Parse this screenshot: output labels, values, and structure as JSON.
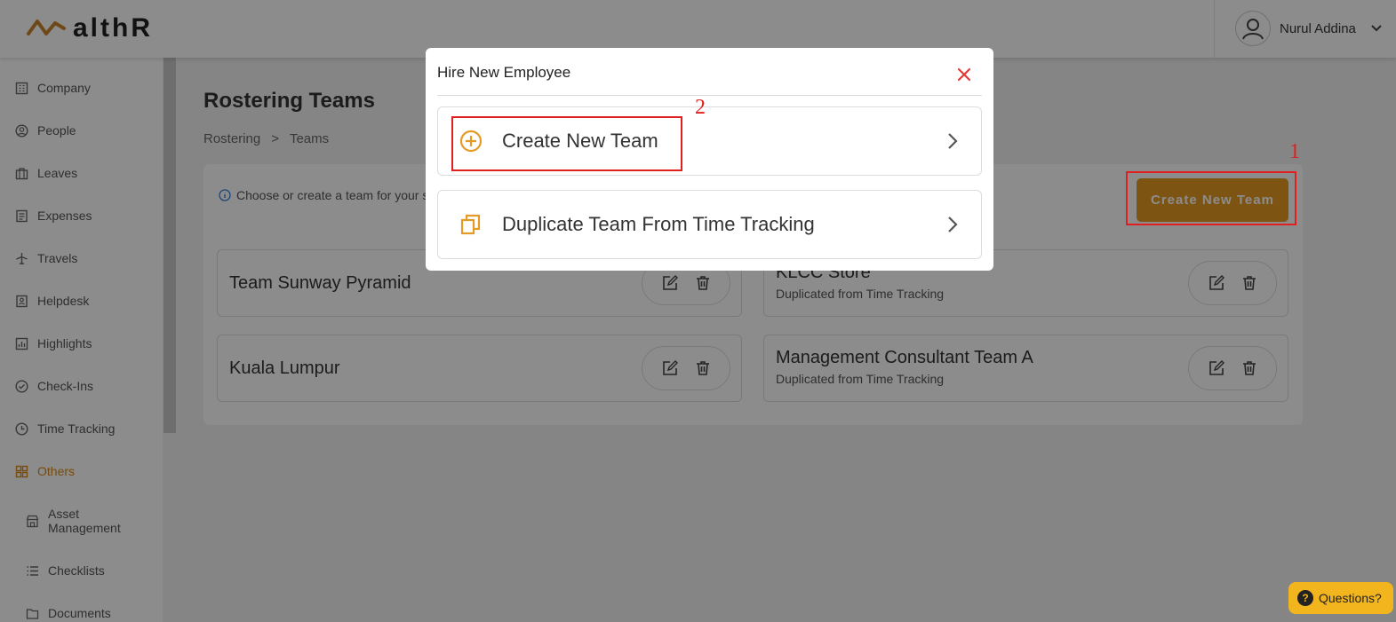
{
  "header": {
    "logo_text": "althR",
    "user_name": "Nurul Addina"
  },
  "sidebar": {
    "items": [
      {
        "label": "Company",
        "icon": "building-icon"
      },
      {
        "label": "People",
        "icon": "user-circle-icon"
      },
      {
        "label": "Leaves",
        "icon": "briefcase-icon"
      },
      {
        "label": "Expenses",
        "icon": "receipt-icon"
      },
      {
        "label": "Travels",
        "icon": "plane-icon"
      },
      {
        "label": "Helpdesk",
        "icon": "helpdesk-icon"
      },
      {
        "label": "Highlights",
        "icon": "chart-icon"
      },
      {
        "label": "Check-Ins",
        "icon": "check-circle-icon"
      },
      {
        "label": "Time Tracking",
        "icon": "clock-icon"
      },
      {
        "label": "Others",
        "icon": "grid-icon",
        "active": true
      }
    ],
    "sub_items": [
      {
        "label_line1": "Asset",
        "label_line2": "Management",
        "icon": "store-icon"
      },
      {
        "label": "Checklists",
        "icon": "list-icon"
      },
      {
        "label": "Documents",
        "icon": "folder-icon"
      }
    ],
    "accent_color": "#d8891a"
  },
  "main": {
    "title": "Rostering Teams",
    "breadcrumb": [
      "Rostering",
      ">",
      "Teams"
    ],
    "info_text": "Choose or create a team for your s",
    "create_button": "Create New Team",
    "teams": [
      {
        "name": "Team Sunway Pyramid",
        "subtitle": ""
      },
      {
        "name": "KLCC Store",
        "subtitle": "Duplicated from Time Tracking"
      },
      {
        "name": "Kuala Lumpur",
        "subtitle": ""
      },
      {
        "name": "Management Consultant Team A",
        "subtitle": "Duplicated from Time Tracking"
      }
    ]
  },
  "modal": {
    "title": "Hire New Employee",
    "options": [
      {
        "label": "Create New Team",
        "icon": "plus-circle-icon"
      },
      {
        "label": "Duplicate Team From Time Tracking",
        "icon": "copy-icon"
      }
    ]
  },
  "annotations": [
    "1",
    "2"
  ],
  "help": {
    "label": "Questions?"
  },
  "colors": {
    "brand": "#e59a24",
    "close": "#e53935",
    "annotation": "#e02020"
  }
}
